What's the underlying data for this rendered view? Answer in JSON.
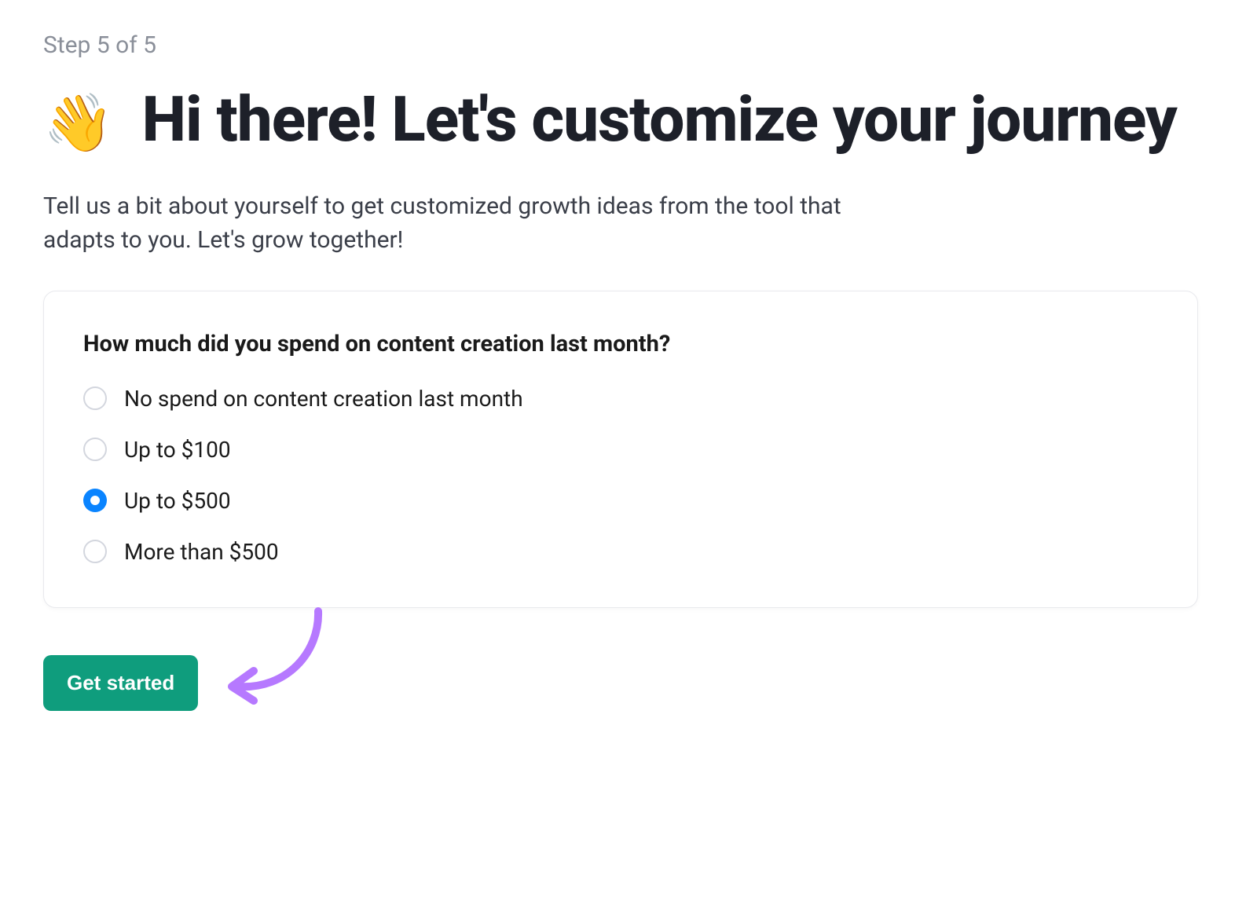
{
  "step_indicator": "Step 5 of 5",
  "heading_emoji": "👋",
  "heading_text": " Hi there! Let's customize your journey",
  "subheading": "Tell us a bit about yourself to get customized growth ideas from the tool that adapts to you. Let's grow together!",
  "question": "How much did you spend on content creation last month?",
  "options": [
    {
      "label": "No spend on content creation last month",
      "selected": false
    },
    {
      "label": "Up to $100",
      "selected": false
    },
    {
      "label": "Up to $500",
      "selected": true
    },
    {
      "label": "More than $500",
      "selected": false
    }
  ],
  "cta_label": "Get started"
}
